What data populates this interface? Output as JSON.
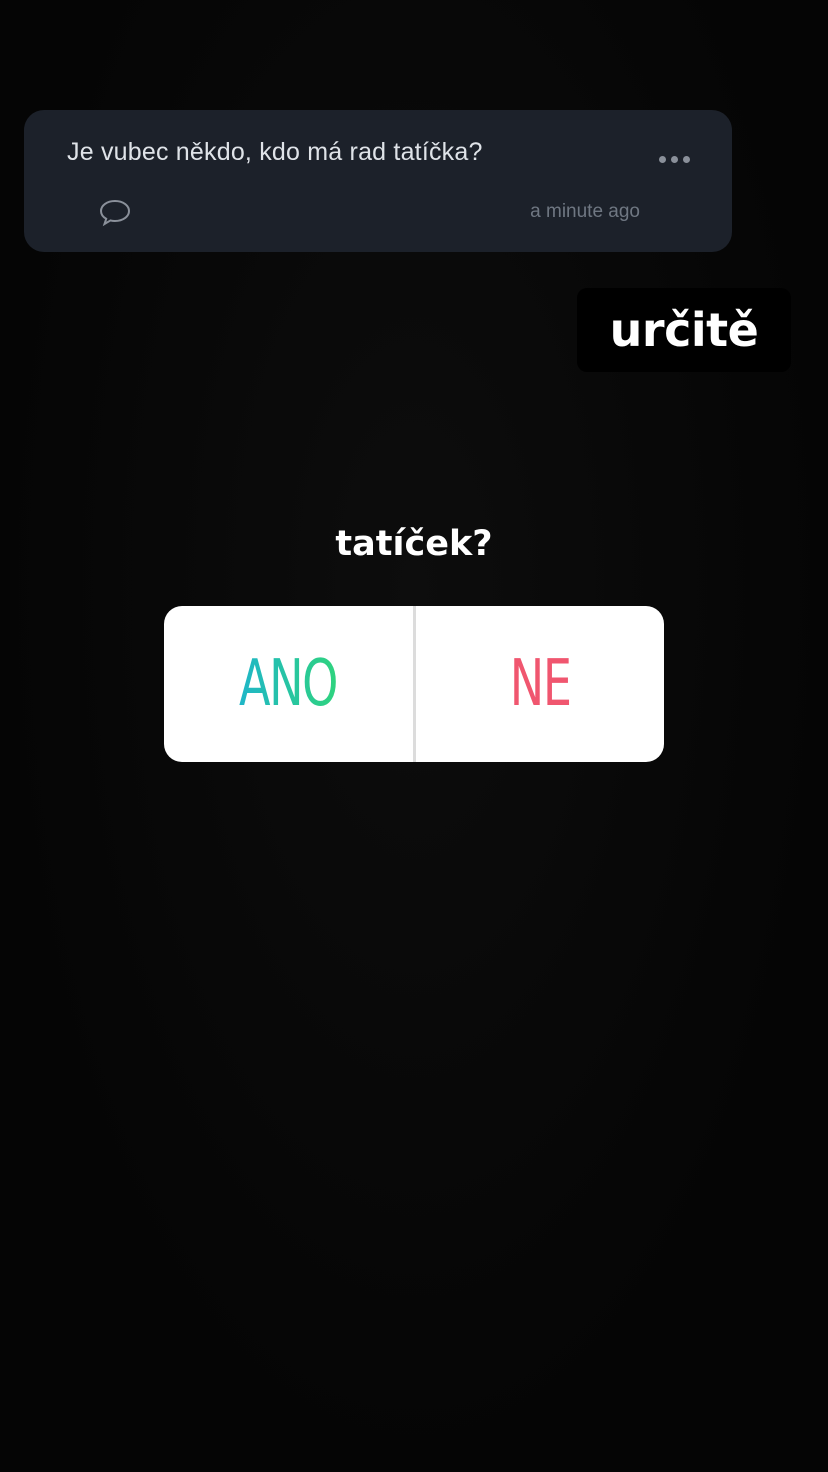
{
  "question_card": {
    "text": "Je vubec někdo, kdo má rad tatíčka?",
    "timestamp": "a minute ago",
    "more_icon": "more-horizontal-icon",
    "comment_icon": "comment-bubble-icon"
  },
  "answer": {
    "text": "určitě"
  },
  "poll": {
    "question": "tatíček?",
    "options": [
      {
        "label": "ANO",
        "color_from": "#1fb6c8",
        "color_to": "#2fd37e"
      },
      {
        "label": "NE",
        "color": "#f0566f"
      }
    ]
  },
  "colors": {
    "background": "#050505",
    "card": "#1c212a",
    "card_text": "#dfe3e8",
    "muted_text": "#6f7782"
  }
}
